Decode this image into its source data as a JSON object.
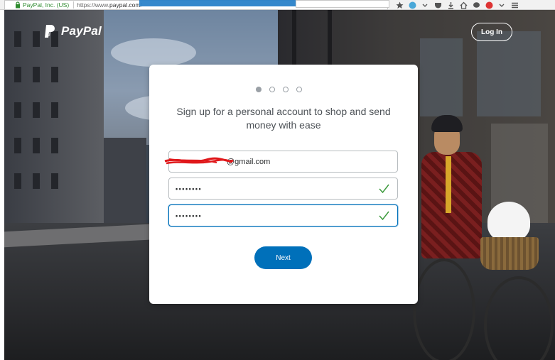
{
  "browser": {
    "site_identity": "PayPal, Inc. (US)",
    "url_prefix": "https://www.",
    "url_domain": "paypal.com",
    "url_rest": "/"
  },
  "header": {
    "logo_text": "PayPal",
    "login_label": "Log In"
  },
  "signup": {
    "step_indicator": {
      "total": 4,
      "current": 1
    },
    "headline": "Sign up for a personal account to shop and send money with ease",
    "email_value": "@gmail.com",
    "password_value": "••••••••",
    "confirm_password_value": "••••••••",
    "next_label": "Next"
  },
  "colors": {
    "brand_blue": "#0070ba",
    "check_green": "#3c9a3c",
    "redaction_red": "#e0181b"
  }
}
